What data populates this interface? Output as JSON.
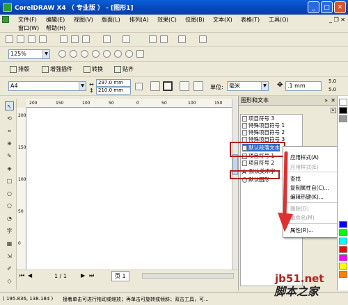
{
  "window": {
    "title": "CorelDRAW X4 （ 专业版 ） - [图形1]"
  },
  "menu": {
    "row1": [
      "文件(F)",
      "编辑(E)",
      "视图(V)",
      "版面(L)",
      "排列(A)",
      "效果(C)",
      "位图(B)",
      "文本(X)",
      "表格(T)",
      "工具(O)"
    ],
    "row2": [
      "窗口(W)",
      "帮助(H)"
    ]
  },
  "toolbar": {
    "zoom": "125%"
  },
  "ribbon": {
    "typeset": "排版",
    "enhance": "增强插件",
    "convert": "转换",
    "paste": "贴齐"
  },
  "property_bar": {
    "page_size": "A4",
    "width": "297.0 mm",
    "height": "210.0 mm",
    "unit_label": "单位:",
    "unit": "毫米",
    "nudge": ".1 mm",
    "r1": "5.0",
    "r2": "5.0"
  },
  "ruler": {
    "h": [
      "200",
      "150",
      "100",
      "50",
      "0",
      "50",
      "100",
      "150"
    ],
    "v": [
      "200",
      "150",
      "100",
      "50",
      "0"
    ]
  },
  "docker": {
    "title": "图形和文本",
    "items": [
      "项目符号 3",
      "特殊项目符号 1",
      "特殊项目符号 2",
      "特殊项目符号 3",
      "默认段落文本",
      "项目符号 1",
      "项目符号 2",
      "默认美术字",
      "默认图形"
    ]
  },
  "context_menu": {
    "items": [
      {
        "label": "应用样式(A)",
        "disabled": false
      },
      {
        "label": "应用样式(E)",
        "disabled": true
      },
      {
        "label": "查找",
        "disabled": false
      },
      {
        "label": "复制属性自(C)...",
        "disabled": false
      },
      {
        "label": "编辑热键(K)...",
        "disabled": false
      },
      {
        "label": "删除(D)",
        "disabled": true
      },
      {
        "label": "重命名(M)",
        "disabled": true
      },
      {
        "label": "属性(R)...",
        "disabled": false
      }
    ]
  },
  "page_nav": {
    "counter": "1 / 1",
    "tab": "页 1"
  },
  "statusbar": {
    "coords": "( 195.836, 138.184 )",
    "hint": "接着单击可进行拖动或缩放；再单击可旋转或倾斜；双击工具，可..."
  },
  "watermark": {
    "line1": "jb51.net",
    "line2": "脚本之家"
  },
  "palette": [
    "#ffffff",
    "#000000",
    "#999999",
    "#0000ff",
    "#00ff00",
    "#00ffff",
    "#ff0000",
    "#ff00ff",
    "#ffff00",
    "#ff8000",
    "#8000ff",
    "#008000"
  ]
}
